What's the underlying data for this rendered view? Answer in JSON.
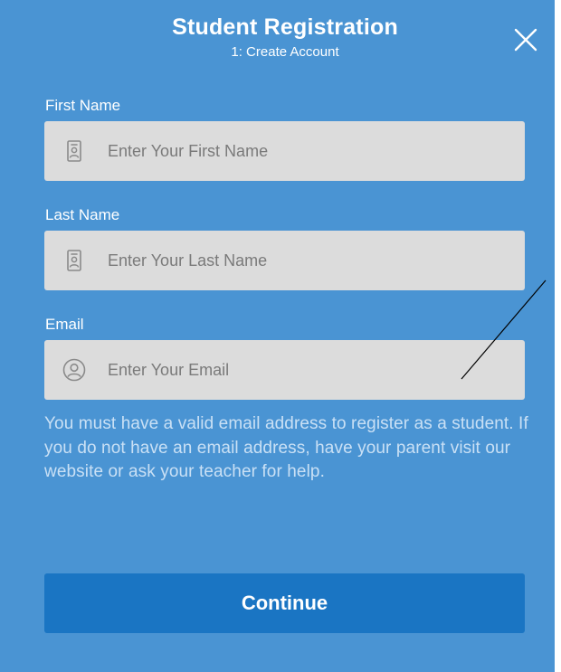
{
  "header": {
    "title": "Student Registration",
    "subtitle": "1: Create Account"
  },
  "form": {
    "first_name": {
      "label": "First Name",
      "placeholder": "Enter Your First Name",
      "value": "",
      "icon": "id-badge-icon"
    },
    "last_name": {
      "label": "Last Name",
      "placeholder": "Enter Your Last Name",
      "value": "",
      "icon": "id-badge-icon"
    },
    "email": {
      "label": "Email",
      "placeholder": "Enter Your Email",
      "value": "",
      "icon": "user-circle-icon"
    },
    "help_text": "You must have a valid email address to register as a student. If you do not have an email address, have your parent visit our website or ask your teacher for help."
  },
  "actions": {
    "continue_label": "Continue"
  },
  "colors": {
    "panel_background": "#4a94d3",
    "field_background": "#dcdcdc",
    "button_background": "#1a75c3",
    "help_text": "#c9e0f5"
  }
}
